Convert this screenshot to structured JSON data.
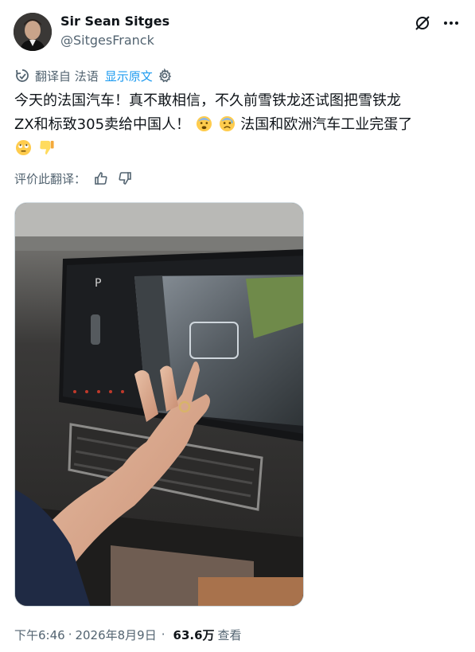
{
  "author": {
    "display_name": "Sir Sean Sitges",
    "handle": "@SitgesFranck"
  },
  "icons": {
    "grok": "grok-slash-circle-icon",
    "more": "more-options-icon",
    "translate": "translate-icon",
    "settings": "gear-icon",
    "thumb_up": "thumb-up-icon",
    "thumb_down": "thumb-down-icon"
  },
  "translation": {
    "translated_from": "翻译自 法语",
    "show_original": "显示原文",
    "rate_label": "评价此翻译："
  },
  "tweet": {
    "line1": "今天的法国汽车！真不敢相信，不久前雪铁龙还试图把雪铁龙",
    "line2_a": "ZX和标致305卖给中国人！",
    "line2_b": "法国和欧洲汽车工业完蛋了",
    "emojis": [
      "fearful-face",
      "anxious-face-with-sweat",
      "face-with-rolling-eyes",
      "thumbs-down"
    ]
  },
  "media": {
    "screen_label_p": "P"
  },
  "footer": {
    "time": "下午6:46",
    "date": "2026年8月9日",
    "separator": "·",
    "views": "63.6万",
    "views_label": "查看"
  },
  "colors": {
    "text": "#0f1419",
    "secondary": "#536471",
    "link": "#1d9bf0"
  }
}
